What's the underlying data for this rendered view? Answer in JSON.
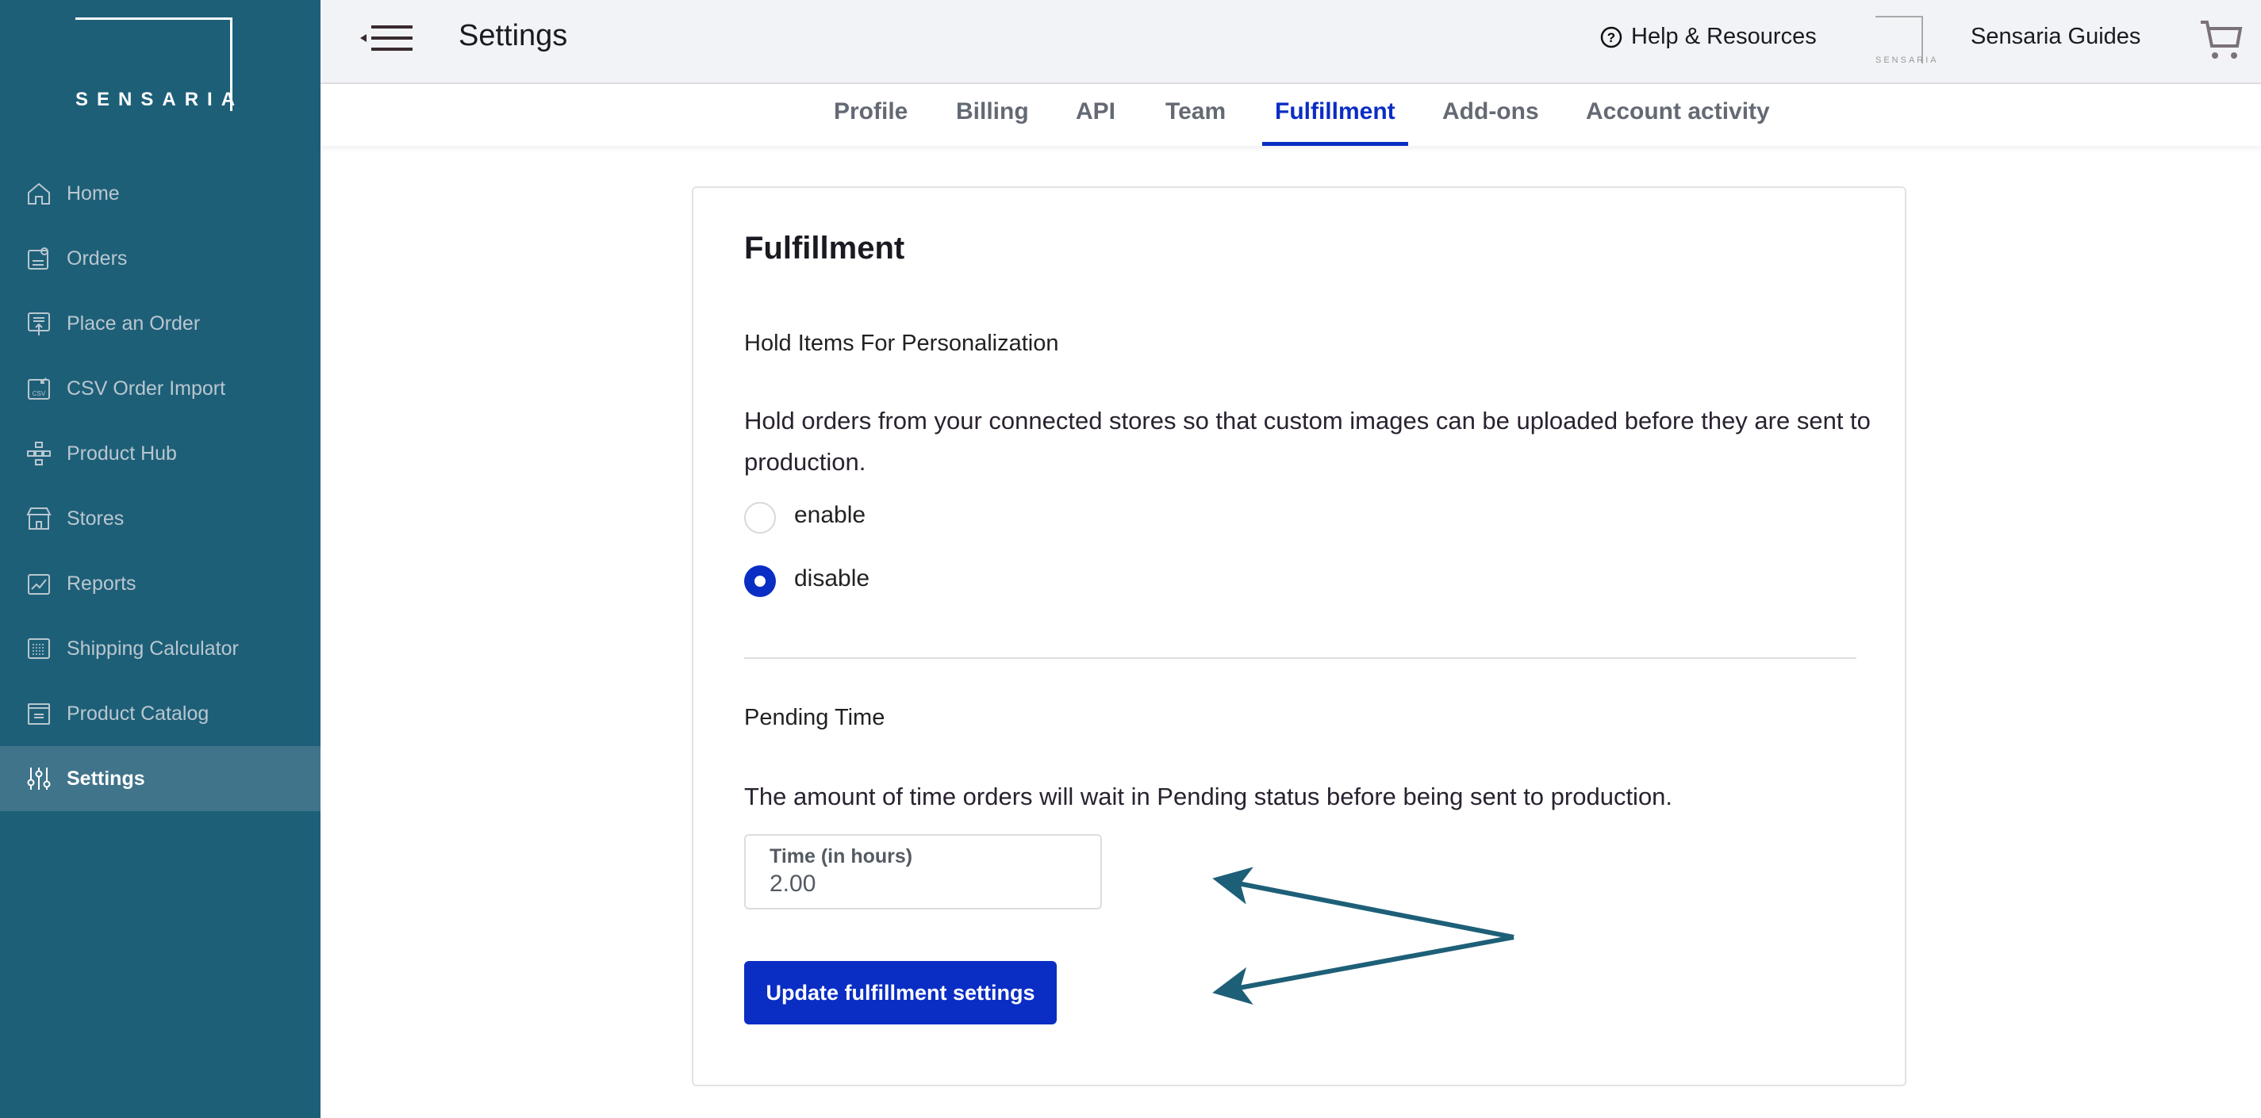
{
  "brand": {
    "logo_text": "SENSARIA"
  },
  "sidebar": {
    "items": [
      {
        "label": "Home",
        "icon": "home-icon"
      },
      {
        "label": "Orders",
        "icon": "orders-icon"
      },
      {
        "label": "Place an Order",
        "icon": "place-order-icon"
      },
      {
        "label": "CSV Order Import",
        "icon": "csv-import-icon"
      },
      {
        "label": "Product Hub",
        "icon": "product-hub-icon"
      },
      {
        "label": "Stores",
        "icon": "store-icon"
      },
      {
        "label": "Reports",
        "icon": "reports-icon"
      },
      {
        "label": "Shipping Calculator",
        "icon": "calculator-icon"
      },
      {
        "label": "Product Catalog",
        "icon": "catalog-icon"
      },
      {
        "label": "Settings",
        "icon": "settings-sliders-icon",
        "active": true
      }
    ]
  },
  "header": {
    "title": "Settings",
    "help_label": "Help & Resources",
    "guides_logo": "SENSARIA",
    "guides_label": "Sensaria Guides"
  },
  "tabs": [
    {
      "label": "Profile"
    },
    {
      "label": "Billing"
    },
    {
      "label": "API"
    },
    {
      "label": "Team"
    },
    {
      "label": "Fulfillment",
      "active": true
    },
    {
      "label": "Add-ons"
    },
    {
      "label": "Account activity"
    }
  ],
  "card": {
    "title": "Fulfillment",
    "hold": {
      "title": "Hold Items For Personalization",
      "description": "Hold orders from your connected stores so that custom images can be uploaded before they are sent to production.",
      "options": [
        {
          "label": "enable",
          "selected": false
        },
        {
          "label": "disable",
          "selected": true
        }
      ]
    },
    "pending": {
      "title": "Pending Time",
      "description": "The amount of time orders will wait in Pending status before being sent to production.",
      "field_label": "Time (in hours)",
      "field_value": "2.00"
    },
    "submit_label": "Update fulfillment settings"
  },
  "colors": {
    "sidebar": "#1e5f78",
    "sidebar_active": "#40748a",
    "primary": "#0a2dc4",
    "annotation_arrow": "#1e5f78"
  }
}
